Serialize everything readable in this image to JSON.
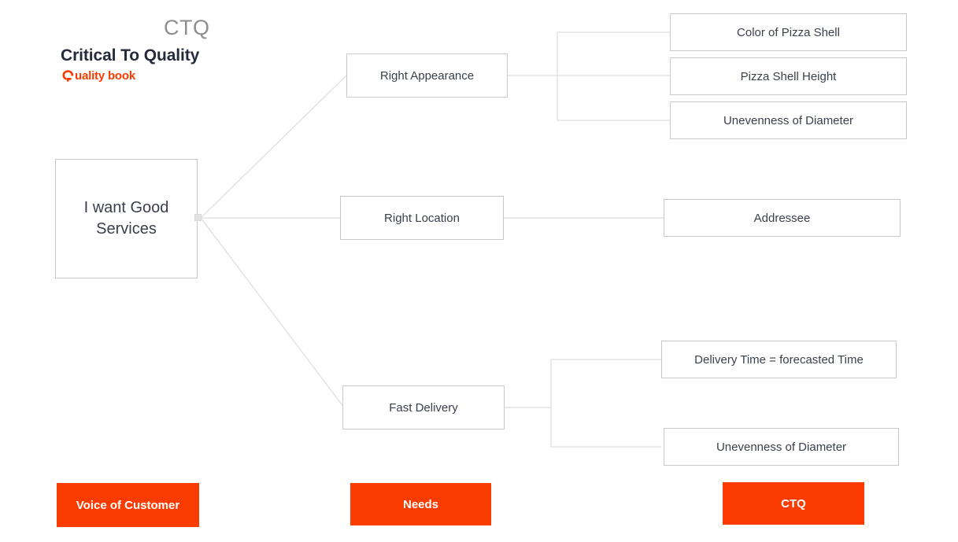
{
  "header": {
    "title": "CTQ",
    "subtitle": "Critical To Quality",
    "brand": "uality book",
    "brand_icon": "quality-book-q-logo",
    "title_color": "#8e8e8e",
    "subtitle_color": "#262b3c",
    "brand_color": "#fa3c00"
  },
  "colors": {
    "accent": "#fa3c00",
    "box_border": "#c9c9c9",
    "wire": "#d9d9d9",
    "text": "#3a3f4c"
  },
  "tree": {
    "root": {
      "label": "I want Good Services",
      "line1": "I want Good",
      "line2": "Services"
    },
    "needs": [
      {
        "label": "Right Appearance"
      },
      {
        "label": "Right Location"
      },
      {
        "label": "Fast Delivery"
      }
    ],
    "ctqs": [
      {
        "label": "Color of Pizza Shell"
      },
      {
        "label": "Pizza Shell Height"
      },
      {
        "label": "Unevenness of Diameter"
      },
      {
        "label": "Addressee"
      },
      {
        "label": "Delivery Time = forecasted Time"
      },
      {
        "label": "Unevenness of Diameter"
      }
    ]
  },
  "legend": [
    {
      "label": "Voice of Customer"
    },
    {
      "label": "Needs"
    },
    {
      "label": "CTQ"
    }
  ]
}
